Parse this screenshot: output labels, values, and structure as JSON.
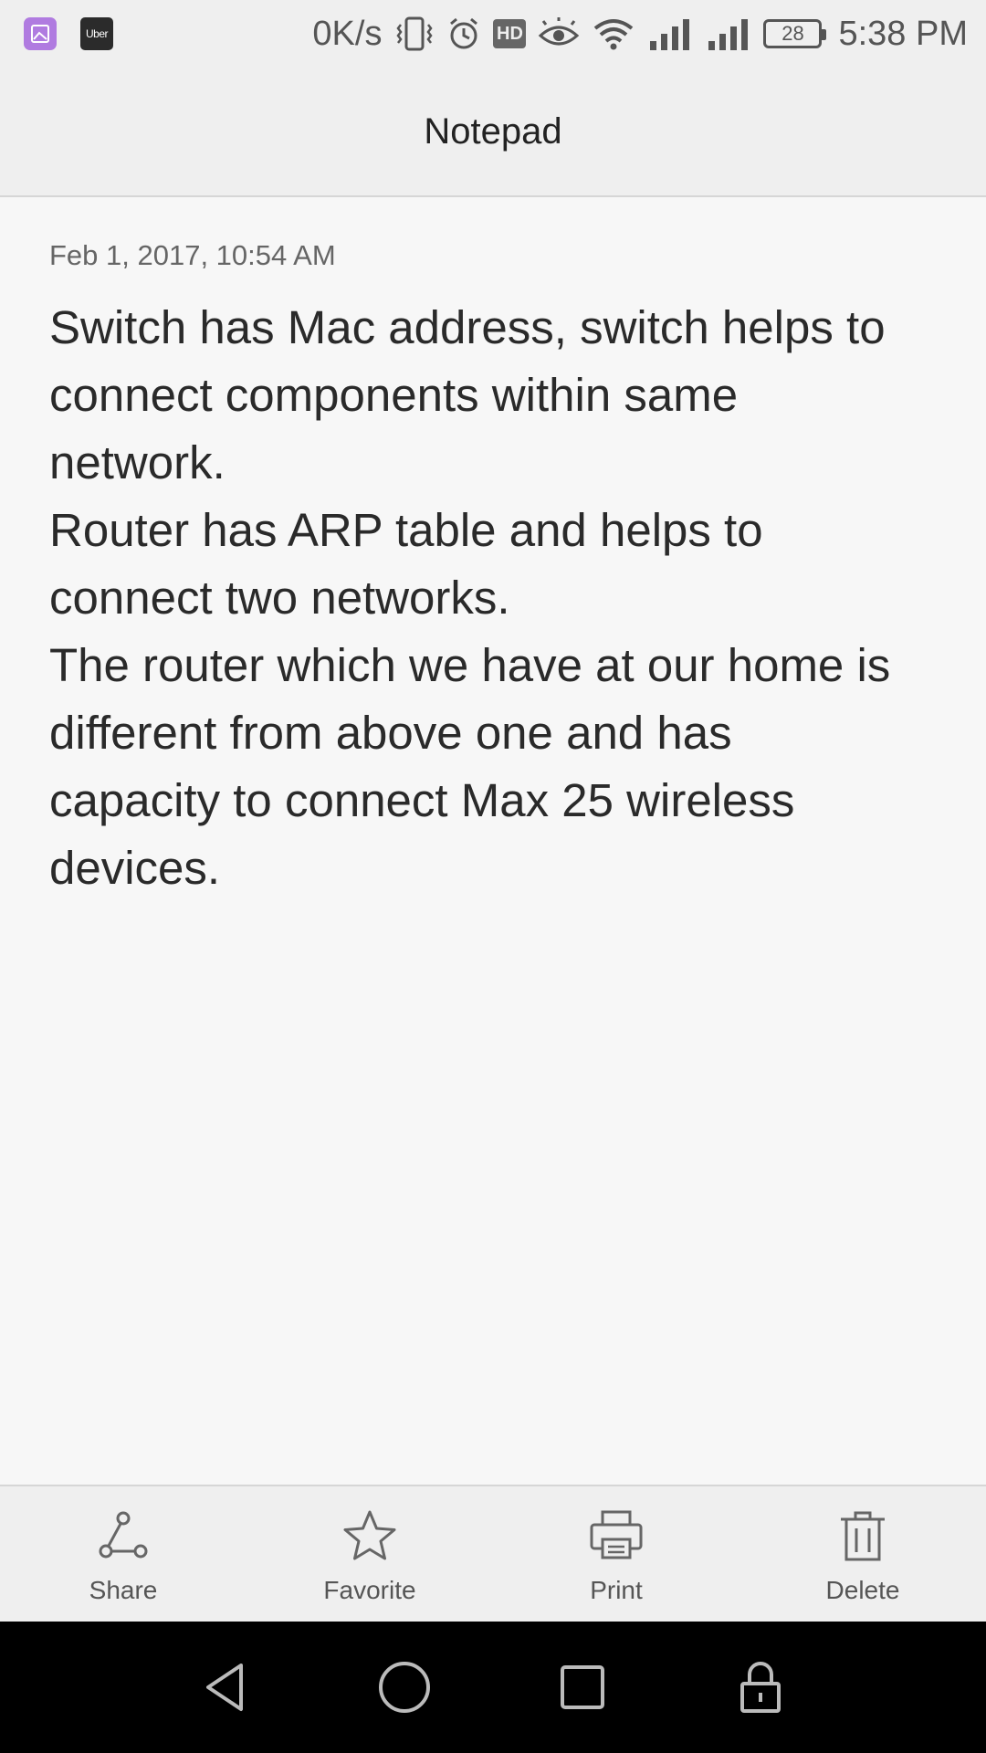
{
  "status_bar": {
    "net_speed": "0K/s",
    "hd_label": "HD",
    "battery_level": "28",
    "time": "5:38 PM",
    "uber_label": "Uber",
    "icons": [
      "gallery-app-icon",
      "uber-app-icon",
      "vibrate-icon",
      "alarm-icon",
      "hd-icon",
      "eye-comfort-icon",
      "wifi-icon",
      "signal-icon",
      "signal-icon",
      "battery-icon"
    ]
  },
  "header": {
    "title": "Notepad"
  },
  "note": {
    "date": "Feb 1, 2017, 10:54 AM",
    "body": "Switch has Mac address, switch helps to\nconnect components within same\nnetwork.\nRouter has ARP table and helps to\nconnect two networks.\nThe router which we have at our home is\ndifferent from above one and has\ncapacity to connect Max 25 wireless\ndevices."
  },
  "actions": [
    {
      "label": "Share",
      "icon": "share-icon"
    },
    {
      "label": "Favorite",
      "icon": "star-icon"
    },
    {
      "label": "Print",
      "icon": "printer-icon"
    },
    {
      "label": "Delete",
      "icon": "trash-icon"
    }
  ],
  "nav": [
    "back-icon",
    "home-icon",
    "recents-icon",
    "lock-icon"
  ],
  "colors": {
    "background": "#f7f7f7",
    "bar": "#efefef",
    "text": "#2a2a2a",
    "icon": "#5a5a5a"
  }
}
